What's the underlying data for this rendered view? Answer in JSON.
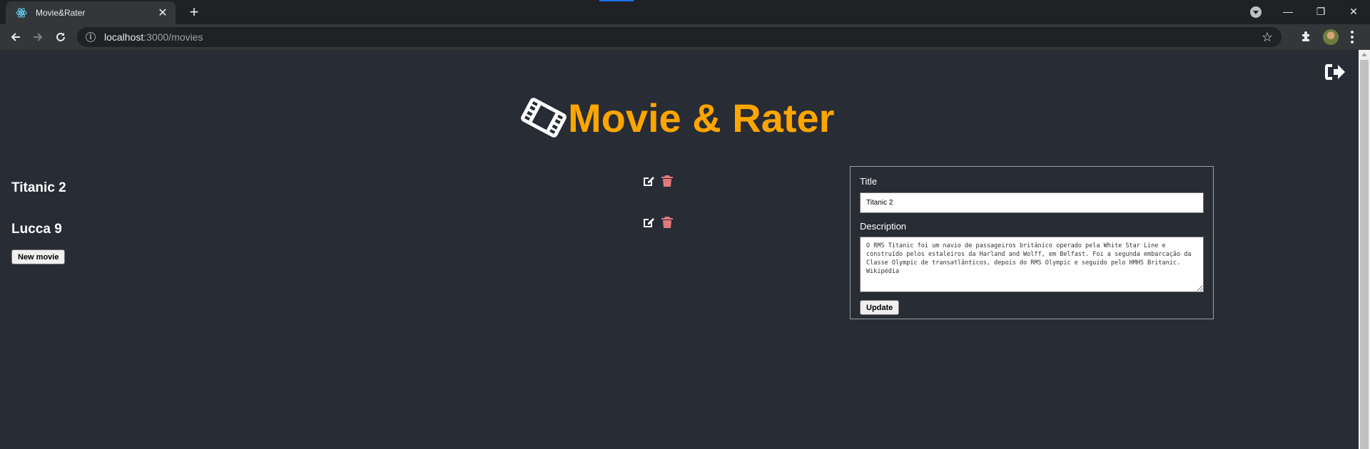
{
  "browser": {
    "tab_title": "Movie&Rater",
    "tab_close": "✕",
    "new_tab": "+",
    "url_host": "localhost",
    "url_path": ":3000/movies",
    "info_glyph": "i",
    "star_glyph": "☆",
    "win_min": "—",
    "win_max": "❐",
    "win_close": "✕"
  },
  "app": {
    "title": "Movie & Rater",
    "title_color": "#ffa500",
    "logo_icon": "film-icon",
    "logout_icon": "sign-out-icon"
  },
  "movies": [
    {
      "title": "Titanic 2"
    },
    {
      "title": "Lucca 9"
    }
  ],
  "new_movie_label": "New movie",
  "form": {
    "title_label": "Title",
    "title_value": "Titanic 2",
    "description_label": "Description",
    "description_value": "O RMS Titanic foi um navio de passageiros britânico operado pela White Star Line e construído pelos estaleiros da Harland and Wolff, em Belfast. Foi a segunda embarcação da Classe Olympic de transatlânticos, depois do RMS Olympic e seguido pelo HMHS Britanic. Wikipédia",
    "update_label": "Update"
  },
  "colors": {
    "background": "#282c34",
    "edit_icon": "#ffffff",
    "delete_icon": "#e07a7a"
  }
}
